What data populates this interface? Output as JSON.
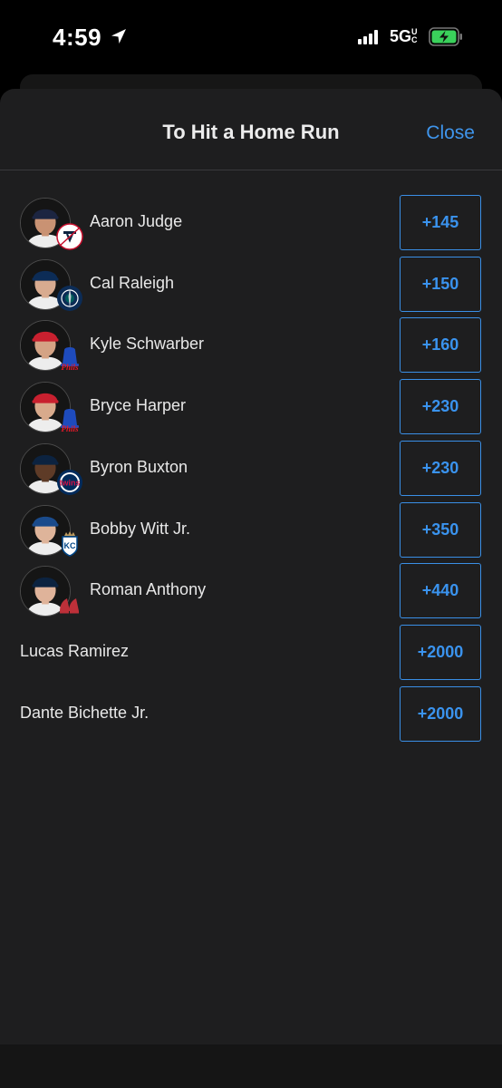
{
  "status": {
    "time": "4:59",
    "network": "5G",
    "network_suffix": "UC",
    "battery_state": "charging"
  },
  "sheet": {
    "title": "To Hit a Home Run",
    "close_label": "Close"
  },
  "players": [
    {
      "name": "Aaron Judge",
      "odds": "+145",
      "team": "yankees",
      "cap_color": "#1c2541",
      "skin": "#c99273"
    },
    {
      "name": "Cal Raleigh",
      "odds": "+150",
      "team": "mariners",
      "cap_color": "#0c2c56",
      "skin": "#d8ab90"
    },
    {
      "name": "Kyle Schwarber",
      "odds": "+160",
      "team": "phillies",
      "cap_color": "#c8202f",
      "skin": "#d4a385"
    },
    {
      "name": "Bryce Harper",
      "odds": "+230",
      "team": "phillies",
      "cap_color": "#c8202f",
      "skin": "#d8aa8c"
    },
    {
      "name": "Byron Buxton",
      "odds": "+230",
      "team": "twins",
      "cap_color": "#0c2340",
      "skin": "#5e3b27"
    },
    {
      "name": "Bobby Witt Jr.",
      "odds": "+350",
      "team": "royals",
      "cap_color": "#1a4b8c",
      "skin": "#deb49a"
    },
    {
      "name": "Roman Anthony",
      "odds": "+440",
      "team": "red-sox",
      "cap_color": "#0c2340",
      "skin": "#dfb39a"
    },
    {
      "name": "Lucas Ramirez",
      "odds": "+2000",
      "team": "",
      "cap_color": "",
      "skin": ""
    },
    {
      "name": "Dante Bichette Jr.",
      "odds": "+2000",
      "team": "",
      "cap_color": "",
      "skin": ""
    }
  ],
  "colors": {
    "accent": "#3a93ee",
    "sheet_bg": "#1e1e1f",
    "text": "#e8e8e8"
  }
}
